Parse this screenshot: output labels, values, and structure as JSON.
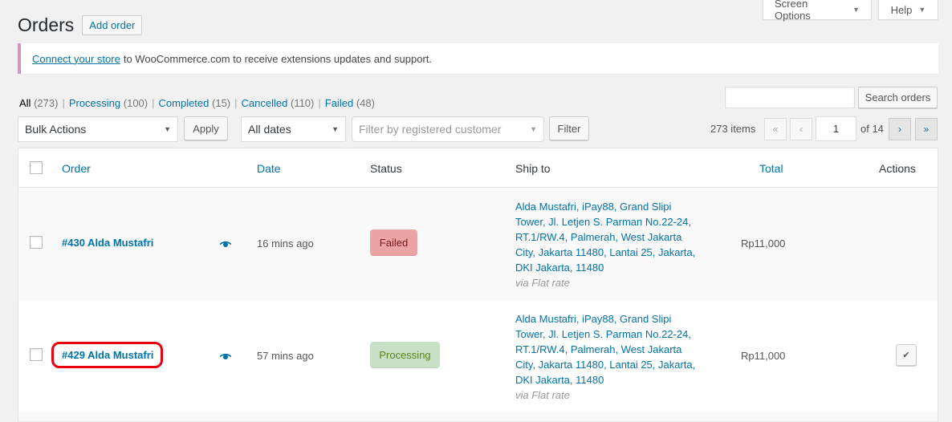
{
  "screen_meta": {
    "screen_options_label": "Screen Options",
    "help_label": "Help"
  },
  "header": {
    "title": "Orders",
    "add_order_label": "Add order"
  },
  "notice": {
    "link_text": "Connect your store",
    "text": "to WooCommerce.com to receive extensions updates and support.",
    "accent_color": "#cc99c2"
  },
  "views": [
    {
      "label": "All",
      "count": "(273)",
      "current": true
    },
    {
      "label": "Processing",
      "count": "(100)",
      "current": false
    },
    {
      "label": "Completed",
      "count": "(15)",
      "current": false
    },
    {
      "label": "Cancelled",
      "count": "(110)",
      "current": false
    },
    {
      "label": "Failed",
      "count": "(48)",
      "current": false
    }
  ],
  "views_separator": "|",
  "search": {
    "value": "",
    "button_label": "Search orders"
  },
  "tablenav": {
    "bulk_actions_value": "Bulk Actions",
    "apply_label": "Apply",
    "dates_value": "All dates",
    "customer_placeholder": "Filter by registered customer",
    "filter_label": "Filter",
    "items_count": "273 items",
    "first_page": "«",
    "prev_page": "‹",
    "current_page": "1",
    "of_pages": "of 14",
    "next_page": "›",
    "last_page": "»"
  },
  "table": {
    "columns": {
      "order": "Order",
      "date": "Date",
      "status": "Status",
      "ship_to": "Ship to",
      "total": "Total",
      "actions": "Actions"
    },
    "rows": [
      {
        "order": "#430 Alda Mustafri",
        "date": "16 mins ago",
        "status": "Failed",
        "status_color": "#eba3a3",
        "ship_lines": [
          "Alda Mustafri, iPay88, Grand Slipi",
          "Tower, Jl. Letjen S. Parman No.22-24,",
          "RT.1/RW.4, Palmerah, West Jakarta",
          "City, Jakarta 11480, Lantai 25, Jakarta,",
          "DKI Jakarta, 11480"
        ],
        "ship_method": "via Flat rate",
        "total": "Rp11,000",
        "highlighted": false
      },
      {
        "order": "#429 Alda Mustafri",
        "date": "57 mins ago",
        "status": "Processing",
        "status_color": "#c6e1c6",
        "ship_lines": [
          "Alda Mustafri, iPay88, Grand Slipi",
          "Tower, Jl. Letjen S. Parman No.22-24,",
          "RT.1/RW.4, Palmerah, West Jakarta",
          "City, Jakarta 11480, Lantai 25, Jakarta,",
          "DKI Jakarta, 11480"
        ],
        "ship_method": "via Flat rate",
        "total": "Rp11,000",
        "action_icon": "✔",
        "highlighted": true
      }
    ]
  },
  "icons": {
    "preview": "eye-icon",
    "complete": "checkmark-icon",
    "dropdown": "triangle-down-icon"
  }
}
